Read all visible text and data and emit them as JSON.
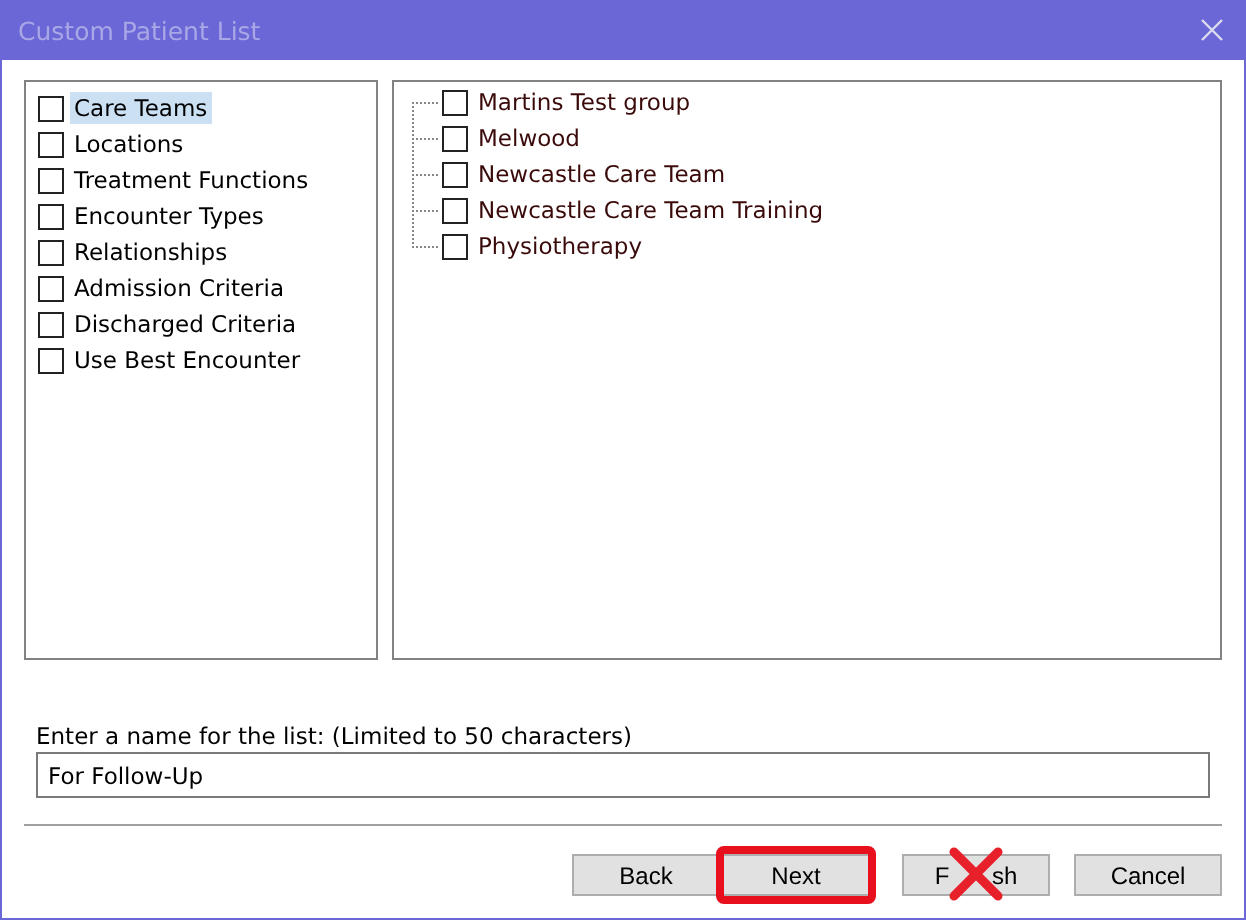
{
  "window": {
    "title": "Custom Patient List"
  },
  "categories": [
    {
      "label": "Care Teams",
      "checked": false,
      "selected": true
    },
    {
      "label": "Locations",
      "checked": false,
      "selected": false
    },
    {
      "label": "Treatment Functions",
      "checked": false,
      "selected": false
    },
    {
      "label": "Encounter Types",
      "checked": false,
      "selected": false
    },
    {
      "label": "Relationships",
      "checked": false,
      "selected": false
    },
    {
      "label": "Admission Criteria",
      "checked": false,
      "selected": false
    },
    {
      "label": "Discharged Criteria",
      "checked": false,
      "selected": false
    },
    {
      "label": "Use Best Encounter",
      "checked": false,
      "selected": false
    }
  ],
  "teams": [
    {
      "label": "Martins Test group",
      "checked": false
    },
    {
      "label": "Melwood",
      "checked": false
    },
    {
      "label": "Newcastle Care Team",
      "checked": false
    },
    {
      "label": "Newcastle Care Team Training",
      "checked": false
    },
    {
      "label": "Physiotherapy",
      "checked": false
    }
  ],
  "name_field": {
    "label": "Enter a name for the list: (Limited to 50 characters)",
    "value": "For Follow-Up"
  },
  "buttons": [
    {
      "label": "Back",
      "highlighted": false,
      "crossed_out": false
    },
    {
      "label": "Next",
      "highlighted": true,
      "crossed_out": false
    },
    {
      "label": "F sh",
      "highlighted": false,
      "crossed_out": true
    },
    {
      "label": "Cancel",
      "highlighted": false,
      "crossed_out": false
    }
  ]
}
